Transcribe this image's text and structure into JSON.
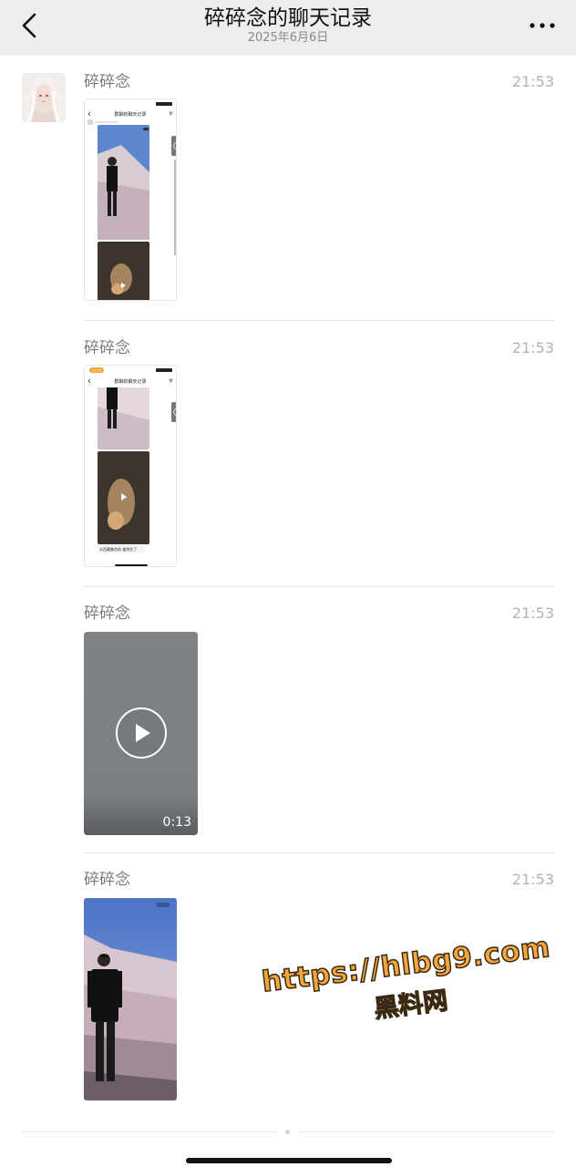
{
  "header": {
    "title": "碎碎念的聊天记录",
    "subtitle": "2025年6月6日"
  },
  "messages": [
    {
      "sender": "碎碎念",
      "time": "21:53",
      "type": "screenshot",
      "inner_title": "群聊的聊天记录",
      "inner_badge": "21:53"
    },
    {
      "sender": "碎碎念",
      "time": "21:53",
      "type": "screenshot",
      "inner_title": "群聊的聊天记录",
      "inner_badge": "21:53",
      "inner_caption": "水西藏集合的 被附住了"
    },
    {
      "sender": "碎碎念",
      "time": "21:53",
      "type": "video",
      "duration": "0:13"
    },
    {
      "sender": "碎碎念",
      "time": "21:53",
      "type": "photo"
    }
  ],
  "watermark": {
    "url": "https://hlbg9.com",
    "name": "黑料网"
  },
  "icons": {
    "back": "chevron-left-icon",
    "more": "more-dots-icon",
    "play": "play-icon"
  },
  "colors": {
    "navbar_bg": "#ededed",
    "accent_watermark": "#f4a53b"
  }
}
